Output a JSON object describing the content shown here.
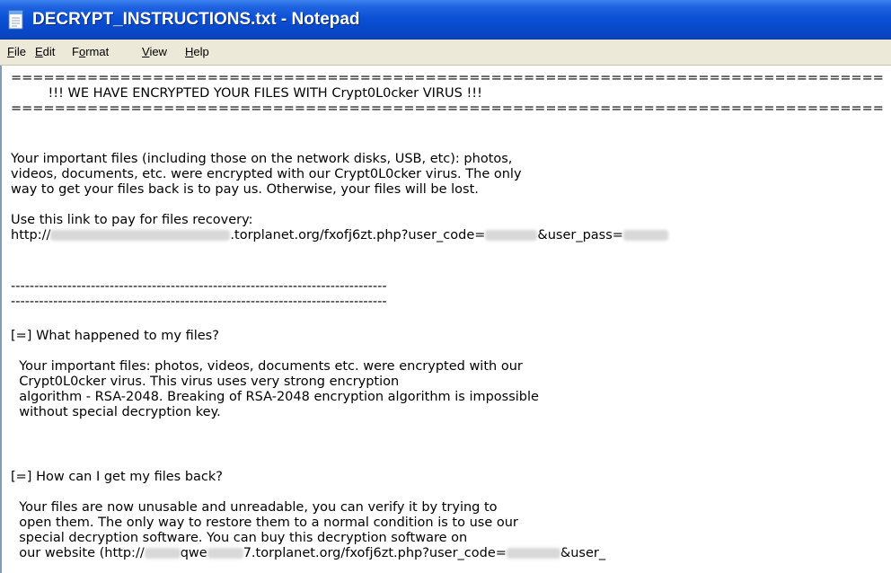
{
  "window": {
    "title": "DECRYPT_INSTRUCTIONS.txt - Notepad",
    "title_icon": "notepad-icon"
  },
  "menu": [
    {
      "label_pre": "",
      "label_key": "F",
      "label_post": "ile"
    },
    {
      "label_pre": "",
      "label_key": "E",
      "label_post": "dit"
    },
    {
      "label_pre": "F",
      "label_key": "o",
      "label_post": "rmat"
    },
    {
      "label_pre": "",
      "label_key": "V",
      "label_post": "iew"
    },
    {
      "label_pre": "",
      "label_key": "H",
      "label_post": "elp"
    }
  ],
  "document": {
    "rule_eq": "================================================================================",
    "banner": "         !!! WE HAVE ENCRYPTED YOUR FILES WITH Crypt0L0cker VIRUS !!!",
    "intro_1": "Your important files (including those on the network disks, USB, etc): photos,",
    "intro_2": "videos, documents, etc. were encrypted with our Crypt0L0cker virus. The only",
    "intro_3": "way to get your files back is to pay us. Otherwise, your files will be lost.",
    "link_label": "Use this link to pay for files recovery:",
    "link_part1": "http://",
    "link_part2": ".torplanet.org/fxofj6zt.php?user_code=",
    "link_part3": "&user_pass=",
    "rule_dash": "--------------------------------------------------------------------------------",
    "q1_heading": "[=] What happened to my files?",
    "q1_1": "  Your important files: photos, videos, documents etc. were encrypted with our",
    "q1_2": "  Crypt0L0cker virus. This virus uses very strong encryption",
    "q1_3": "  algorithm - RSA-2048. Breaking of RSA-2048 encryption algorithm is impossible",
    "q1_4": "  without special decryption key.",
    "q2_heading": "[=] How can I get my files back?",
    "q2_1": "  Your files are now unusable and unreadable, you can verify it by trying to",
    "q2_2": "  open them. The only way to restore them to a normal condition is to use our",
    "q2_3": "  special decryption software. You can buy this decryption software on",
    "q2_4a": "  our website (http://",
    "q2_4b": "qwe",
    "q2_4c": "7.torplanet.org/fxofj6zt.php?user_code=",
    "q2_4d": "&user_"
  }
}
